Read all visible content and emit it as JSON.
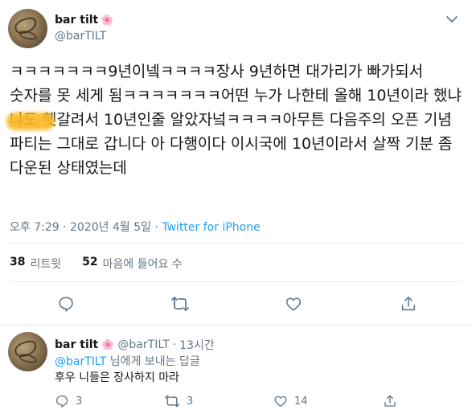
{
  "tweet": {
    "display_name": "bar tilt",
    "blossom": "🌸",
    "handle": "@barTILT",
    "text": "ㅋㅋㅋㅋㅋㅋㅋ9년이넼ㅋㅋㅋㅋ장사 9년하면 대가리가 빠가되서 숫자를 못 세게 됨ㅋㅋㅋㅋㅋㅋㅋ어떤 누가 나한테 올해 10년이라 했냐 나도 헷갈려서 10년인줄 알았자넠ㅋㅋㅋㅋ아무튼 다음주의 오픈 기념 파티는 그대로 갑니다 아 다행이다 이시국에 10년이라서 살짝 기분 좀 다운된 상태였는데",
    "time": "오후 7:29",
    "dot": "·",
    "date": "2020년 4월 5일",
    "source": "Twitter for iPhone",
    "retweets_count": "38",
    "retweets_label": "리트윗",
    "likes_count": "52",
    "likes_label": "마음에 들어요 수"
  },
  "reply": {
    "display_name": "bar tilt",
    "blossom": "🌸",
    "handle": "@barTILT",
    "dot": "·",
    "time": "13시간",
    "mention": "@barTILT",
    "reply_to_suffix": " 님에게 보내는 답글",
    "text": "후우 니들은 장사하지 마라",
    "reply_count": "3",
    "retweet_count": "3",
    "like_count": "14"
  },
  "colors": {
    "accent": "#1da1f2",
    "secondary_text": "#657786",
    "primary_text": "#14171a",
    "redaction": "#fbb824"
  },
  "icons": [
    "chevron-down-icon",
    "reply-icon",
    "retweet-icon",
    "like-icon",
    "share-icon"
  ]
}
